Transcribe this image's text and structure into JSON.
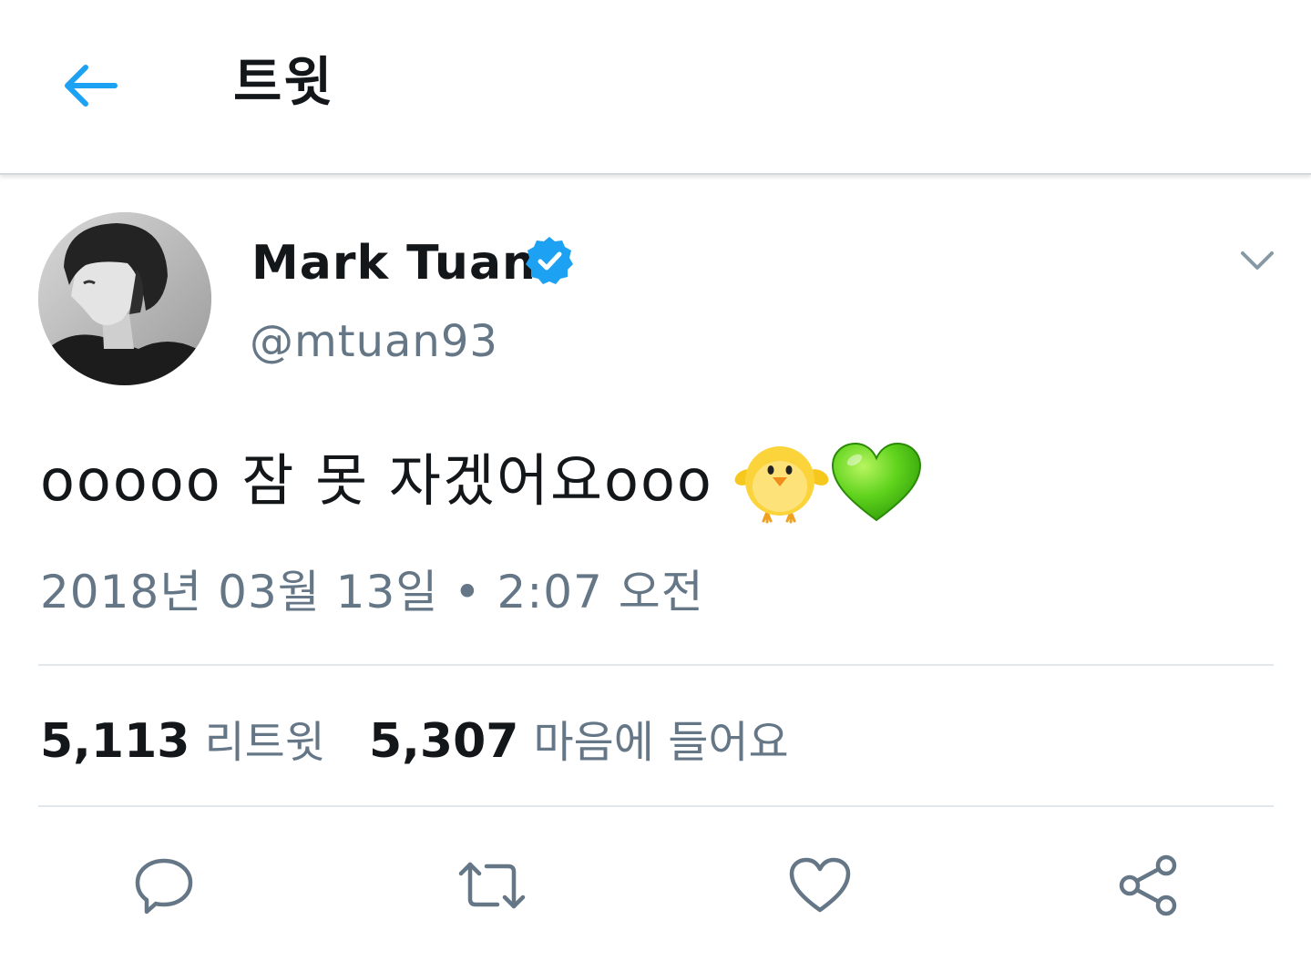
{
  "header": {
    "title": "트윗",
    "back_icon": "arrow-left-icon"
  },
  "tweet": {
    "author": {
      "display_name": "Mark Tuan",
      "handle": "@mtuan93",
      "verified": true,
      "verified_icon": "verified-badge-icon"
    },
    "text": "ooooo 잠 못 자겠어요ooo",
    "emojis": [
      "chick-emoji",
      "green-heart-emoji"
    ],
    "timestamp": "2018년 03월 13일 • 2:07 오전"
  },
  "stats": {
    "retweets_count": "5,113",
    "retweets_label": "리트윗",
    "likes_count": "5,307",
    "likes_label": "마음에 들어요"
  },
  "actions": [
    {
      "name": "reply",
      "icon": "reply-icon"
    },
    {
      "name": "retweet",
      "icon": "retweet-icon"
    },
    {
      "name": "like",
      "icon": "heart-icon"
    },
    {
      "name": "share",
      "icon": "share-icon"
    }
  ],
  "colors": {
    "accent": "#1da1f2",
    "text_primary": "#14171a",
    "text_secondary": "#657786",
    "icon_gray": "#657786",
    "divider": "#e1e8ed"
  }
}
